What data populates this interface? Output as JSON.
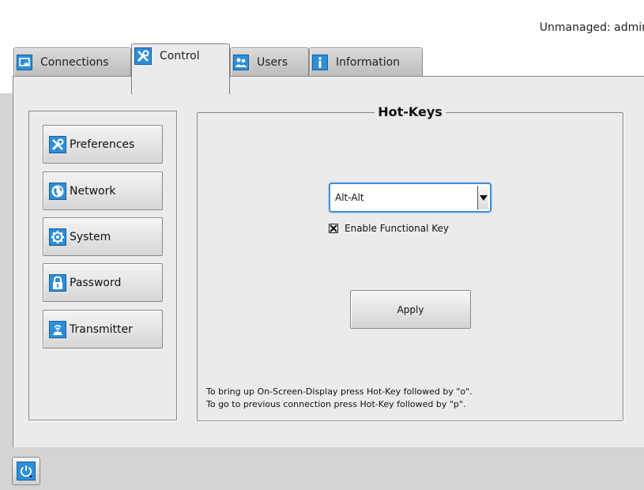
{
  "status": {
    "text": "Unmanaged: admin"
  },
  "tabs": [
    {
      "label": "Connections",
      "icon": "monitor-arrow-icon",
      "active": false
    },
    {
      "label": "Control",
      "icon": "tools-icon",
      "active": true
    },
    {
      "label": "Users",
      "icon": "users-icon",
      "active": false
    },
    {
      "label": "Information",
      "icon": "info-icon",
      "active": false
    }
  ],
  "sidebar": {
    "items": [
      {
        "label": "Preferences",
        "icon": "tools-icon"
      },
      {
        "label": "Network",
        "icon": "globe-icon"
      },
      {
        "label": "System",
        "icon": "gear-icon"
      },
      {
        "label": "Password",
        "icon": "lock-icon"
      },
      {
        "label": "Transmitter",
        "icon": "transmitter-icon"
      }
    ]
  },
  "hotkeys": {
    "title": "Hot-Keys",
    "selected_value": "Alt-Alt",
    "functional_key_label": "Enable Functional Key",
    "functional_key_checked": true,
    "apply_label": "Apply",
    "hint_1": "To bring up On-Screen-Display press Hot-Key followed by \"o\".",
    "hint_2": "To go to previous connection press Hot-Key followed by \"p\"."
  },
  "bottom": {
    "power_icon": "power-menu-icon"
  },
  "colors": {
    "accent": "#2d8ed8",
    "focus": "#3f8fd8"
  }
}
